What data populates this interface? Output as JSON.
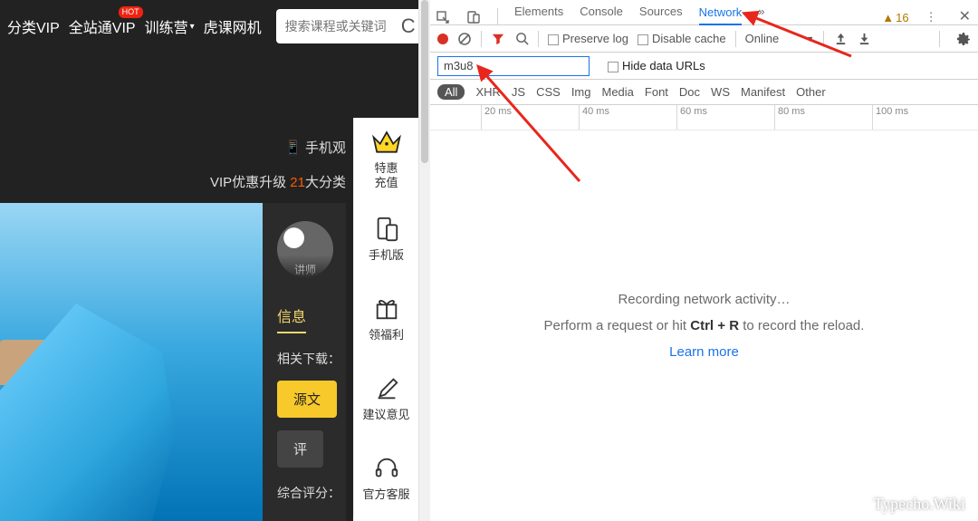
{
  "leftApp": {
    "nav": {
      "item1": "分类VIP",
      "item2": "全站通VIP",
      "hotBadge": "HOT",
      "item3": "训练营",
      "item4": "虎课网机",
      "searchPlaceholder": "搜索课程或关键词"
    },
    "mobileLine": "📱 手机观",
    "vipLine_a": "VIP优惠升级 ",
    "vipLine_b": "21",
    "vipLine_c": "大分类",
    "avatarTag": "讲师",
    "tabInfo": "信息",
    "relDownload": "相关下载：",
    "btnSource": "源文",
    "btnReview": "评",
    "overallRating": "综合评分：",
    "rail": {
      "r1a": "特惠",
      "r1b": "充值",
      "r2": "手机版",
      "r3": "领福利",
      "r4": "建议意见",
      "r5": "官方客服"
    }
  },
  "devtools": {
    "tabs": {
      "elements": "Elements",
      "console": "Console",
      "sources": "Sources",
      "network": "Network",
      "more": "»",
      "warnCount": "16"
    },
    "toolbar": {
      "preserve": "Preserve log",
      "disableCache": "Disable cache",
      "online": "Online"
    },
    "filter": {
      "value": "m3u8",
      "hideData": "Hide data URLs"
    },
    "types": {
      "all": "All",
      "xhr": "XHR",
      "js": "JS",
      "css": "CSS",
      "img": "Img",
      "media": "Media",
      "font": "Font",
      "doc": "Doc",
      "ws": "WS",
      "manifest": "Manifest",
      "other": "Other"
    },
    "timeline": {
      "t20": "20 ms",
      "t40": "40 ms",
      "t60": "60 ms",
      "t80": "80 ms",
      "t100": "100 ms"
    },
    "body": {
      "line1": "Recording network activity…",
      "line2a": "Perform a request or hit ",
      "line2b": "Ctrl + R",
      "line2c": " to record the reload.",
      "learn": "Learn more"
    }
  },
  "watermark": "Typecho.Wiki"
}
